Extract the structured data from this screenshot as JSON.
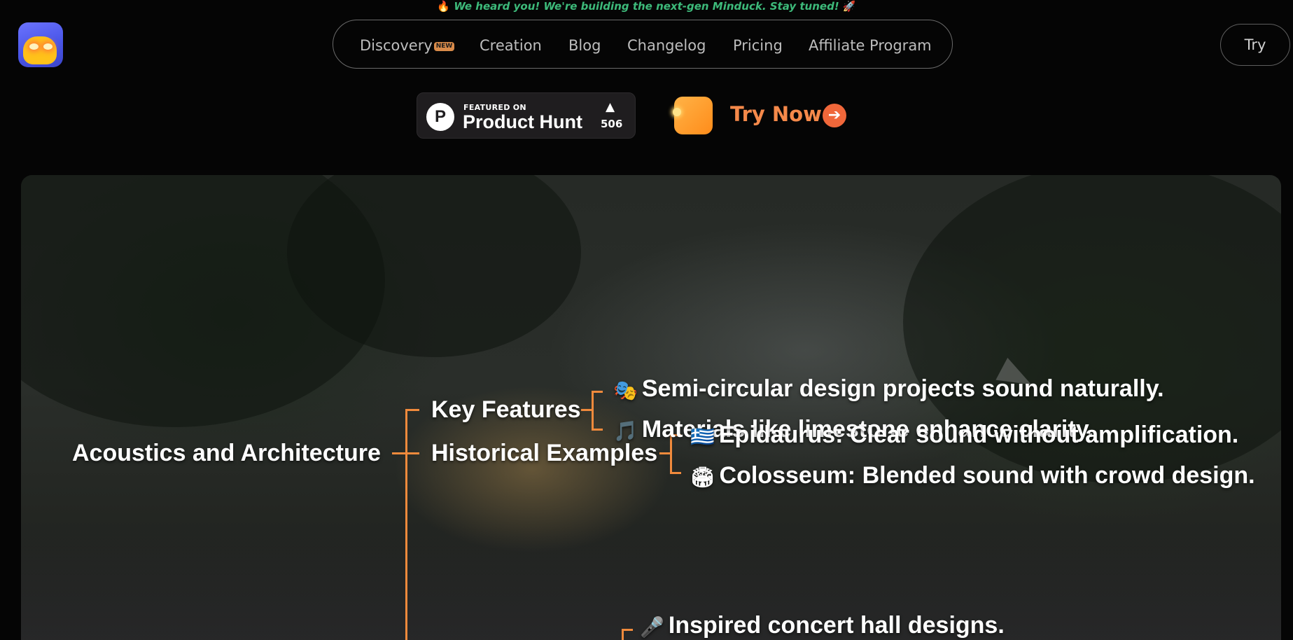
{
  "announcement": {
    "icon": "fire-icon",
    "text": "We heard you! We're building the next-gen Minduck. Stay tuned!",
    "trailing_icon": "rocket-icon",
    "color": "#3dba7a"
  },
  "nav": {
    "items": [
      {
        "label": "Discovery",
        "badge": "NEW"
      },
      {
        "label": "Creation"
      },
      {
        "label": "Blog"
      },
      {
        "label": "Changelog"
      },
      {
        "label": "Pricing"
      },
      {
        "label": "Affiliate Program"
      }
    ],
    "try_label": "Try"
  },
  "product_hunt": {
    "featured": "FEATURED ON",
    "name": "Product Hunt",
    "logo_letter": "P",
    "upvote_icon": "triangle-up-icon",
    "count": "506"
  },
  "cta": {
    "label": "Try Now",
    "color": "#f5894a",
    "arrow_icon": "arrow-right-icon"
  },
  "mindmap": {
    "root": "Acoustics and Architecture",
    "line_color": "#f08a3c",
    "branches": [
      {
        "label": "Key Features",
        "leaves": [
          {
            "emoji": "🎭",
            "text": "Semi-circular design projects sound naturally."
          },
          {
            "emoji": "🎵",
            "text": "Materials like limestone enhance clarity."
          }
        ]
      },
      {
        "label": "Historical Examples",
        "leaves": [
          {
            "emoji": "🇬🇷",
            "text": "Epidaurus: Clear sound without amplification."
          },
          {
            "emoji": "🏟",
            "text": "Colosseum: Blended sound with crowd design."
          }
        ]
      },
      {
        "label": "",
        "leaves": [
          {
            "emoji": "🎤",
            "text": "Inspired concert hall designs."
          }
        ]
      }
    ]
  }
}
